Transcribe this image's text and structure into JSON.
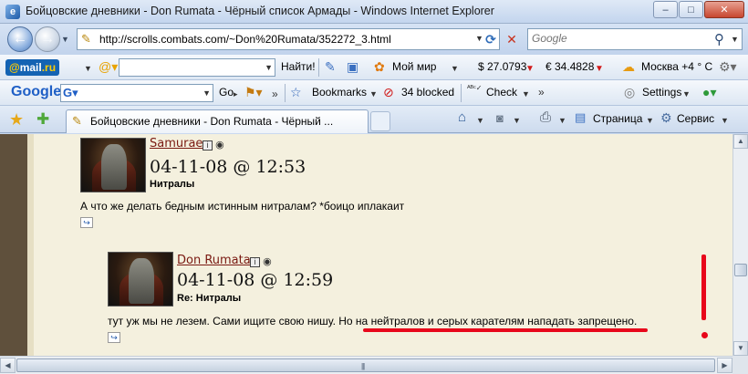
{
  "window": {
    "title": "Бойцовские дневники - Don Rumata - Чёрный список Армады - Windows Internet Explorer",
    "buttons": {
      "minimize": "‒",
      "maximize": "□",
      "close": "✕"
    }
  },
  "address_bar": {
    "url": "http://scrolls.combats.com/~Don%20Rumata/352272_3.html",
    "search_placeholder": "Google"
  },
  "mail_toolbar": {
    "logo_prefix": "@",
    "logo_main": "mail",
    "logo_suffix": ".ru",
    "find_button": "Найти!",
    "my_world": "Мой мир",
    "usd_rate": "$ 27.0793",
    "eur_rate": "€ 34.4828",
    "weather": "Москва +4 ° C"
  },
  "google_toolbar": {
    "logo": "Google",
    "go_button": "Go",
    "bookmarks": "Bookmarks",
    "blocked": "34 blocked",
    "check": "Check",
    "settings": "Settings"
  },
  "tabs": {
    "active_tab": "Бойцовские дневники - Don Rumata - Чёрный ...",
    "page_menu": "Страница",
    "tools_menu": "Сервис"
  },
  "posts": [
    {
      "author": "Samurae",
      "datetime": "04-11-08 @ 12:53",
      "subject": "Нитралы",
      "message": "А что же делать бедным истинным нитралам? *боицо иплакаит"
    },
    {
      "author": "Don Rumata",
      "datetime": "04-11-08 @ 12:59",
      "subject": "Re: Нитралы",
      "message": "тут уж мы не лезем. Сами ищите свою нишу. Но на нейтралов и серых карателям нападать запрещено."
    }
  ],
  "colors": {
    "page_bg": "#f4f0de",
    "author_link": "#7a1a12",
    "annotation_red": "#e8071b",
    "left_band": "#5f503c"
  },
  "icons": {
    "back": "←",
    "forward": "→",
    "refresh": "⟳",
    "stop": "✕",
    "search": "⚲",
    "favorites": "★",
    "add_favorites": "✚",
    "home": "⌂",
    "feeds": "◙",
    "print": "⎙",
    "reply": "↪",
    "info": "i",
    "camera": "◉"
  }
}
